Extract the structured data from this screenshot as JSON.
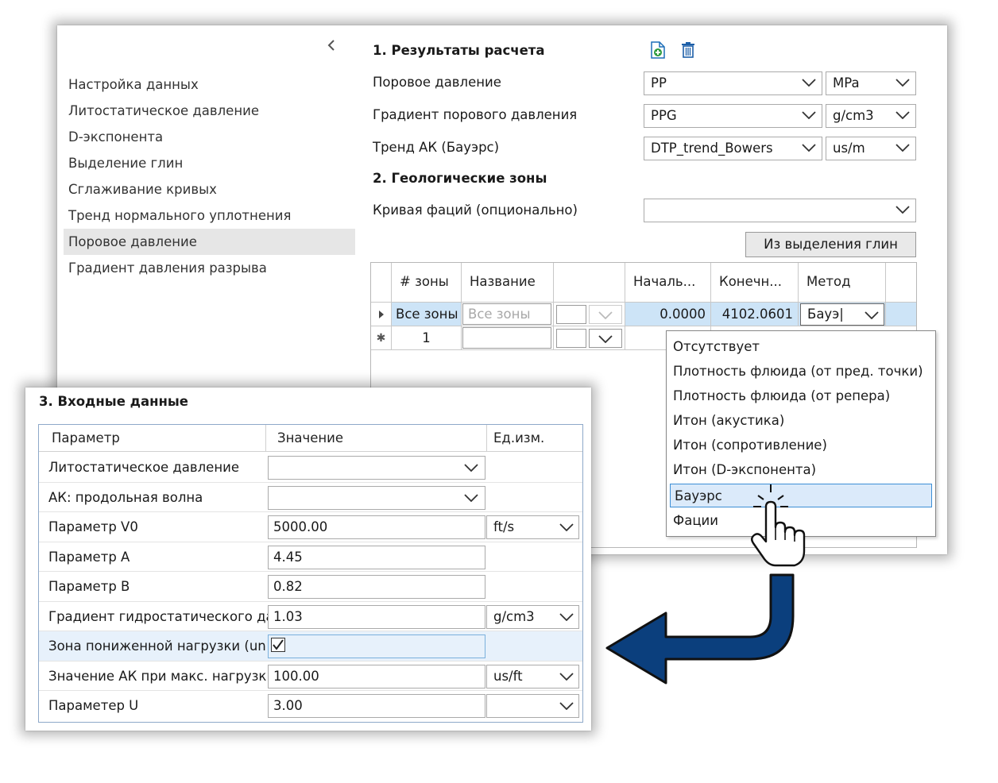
{
  "nav": {
    "collapse_icon": "chevron-left-icon",
    "items": [
      {
        "label": "Настройка данных"
      },
      {
        "label": "Литостатическое давление"
      },
      {
        "label": "D-экспонента"
      },
      {
        "label": "Выделение глин"
      },
      {
        "label": "Сглаживание кривых"
      },
      {
        "label": "Тренд нормального уплотнения"
      },
      {
        "label": "Поровое давление",
        "active": true
      },
      {
        "label": "Градиент давления разрыва"
      }
    ]
  },
  "results": {
    "title": "1. Результаты расчета",
    "add_icon": "add-document-icon",
    "delete_icon": "trash-icon",
    "rows": [
      {
        "label": "Поровое давление",
        "value": "PP",
        "unit": "MPa"
      },
      {
        "label": "Градиент порового давления",
        "value": "PPG",
        "unit": "g/cm3"
      },
      {
        "label": "Тренд АК (Бауэрс)",
        "value": "DTP_trend_Bowers",
        "unit": "us/m"
      }
    ]
  },
  "zones": {
    "title": "2. Геологические зоны",
    "facies_label": "Кривая фаций (опционально)",
    "facies_value": "",
    "from_shale_button": "Из выделения глин",
    "columns": [
      "# зоны",
      "Название",
      "",
      "Началь...",
      "Конечн...",
      "Метод"
    ],
    "row_all": {
      "num": "Все зоны",
      "name_placeholder": "Все зоны",
      "start": "0.0000",
      "end": "4102.0601",
      "method": "Бауэ|"
    },
    "row_new": {
      "num": "1"
    }
  },
  "method_dropdown": {
    "options": [
      "Отсутствует",
      "Плотность флюида (от пред. точки)",
      "Плотность флюида (от репера)",
      "Итон (акустика)",
      "Итон (сопротивление)",
      "Итон (D-экспонента)",
      "Бауэрс",
      "Фации"
    ],
    "selected": "Бауэрс"
  },
  "inputs": {
    "title": "3. Входные данные",
    "columns": {
      "param": "Параметр",
      "value": "Значение",
      "unit": "Ед.изм."
    },
    "rows": [
      {
        "name": "Литостатическое давление",
        "value": "",
        "unit": null,
        "value_dropdown": true
      },
      {
        "name": "АК: продольная волна",
        "value": "",
        "unit": null,
        "value_dropdown": true
      },
      {
        "name": "Параметр V0",
        "value": "5000.00",
        "unit": "ft/s"
      },
      {
        "name": "Параметр A",
        "value": "4.45",
        "unit": null
      },
      {
        "name": "Параметр B",
        "value": "0.82",
        "unit": null
      },
      {
        "name": "Градиент гидростатического да",
        "value": "1.03",
        "unit": "g/cm3"
      },
      {
        "name": "Зона пониженной нагрузки (un",
        "checkbox": true,
        "checked": true
      },
      {
        "name": "Значение АК при макс. нагрузк",
        "value": "100.00",
        "unit": "us/ft"
      },
      {
        "name": "Параметер U",
        "value": "3.00",
        "unit": ""
      }
    ]
  },
  "colors": {
    "accent": "#0b3f7d",
    "selection": "#cde4f7",
    "highlight": "#3c8fd6"
  },
  "cursor_icon": "hand-pointer-icon"
}
